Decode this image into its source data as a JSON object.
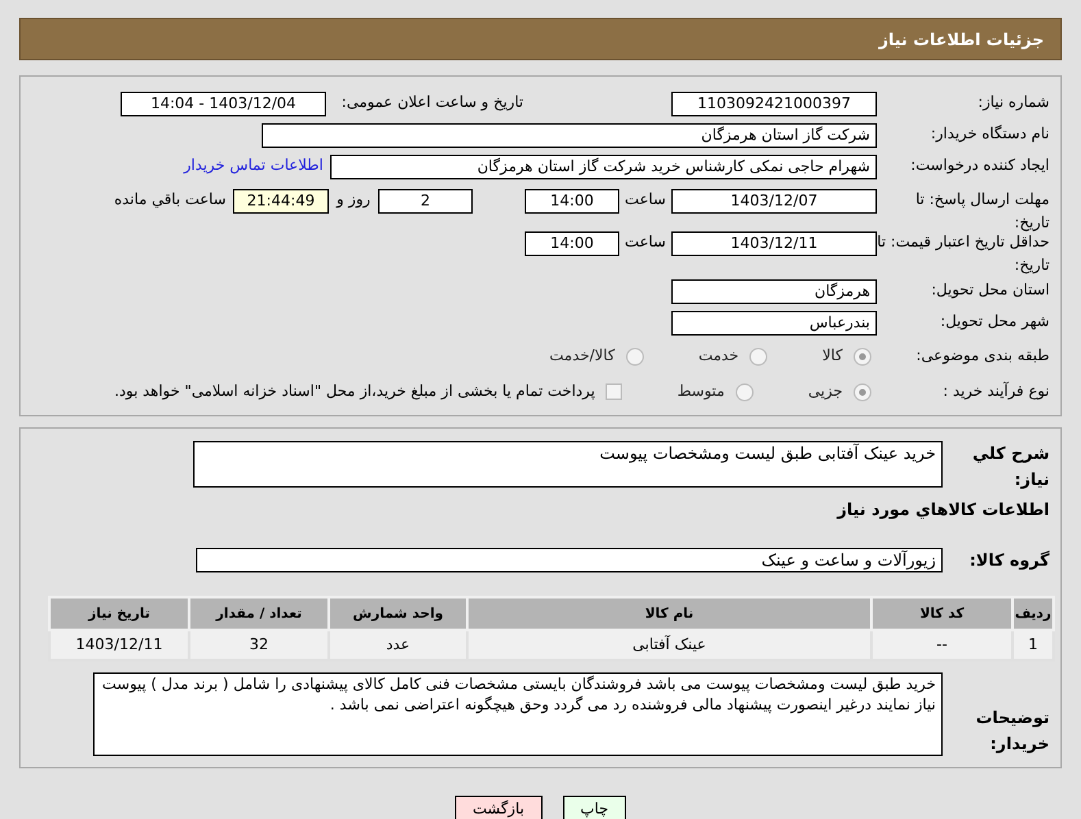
{
  "header": {
    "title": "جزئیات اطلاعات نیاز"
  },
  "need_number": {
    "label": "شماره نیاز:",
    "value": "1103092421000397"
  },
  "announce": {
    "label": "تاریخ و ساعت اعلان عمومی:",
    "value": "1403/12/04 - 14:04"
  },
  "buyer_org": {
    "label": "نام دستگاه خریدار:",
    "value": "شرکت گاز استان هرمزگان"
  },
  "requester": {
    "label": "ایجاد کننده درخواست:",
    "value": "شهرام حاجی نمکی کارشناس خرید شرکت گاز استان هرمزگان",
    "link": "اطلاعات تماس خریدار"
  },
  "reply_deadline": {
    "label": "مهلت ارسال پاسخ: تا تاریخ:",
    "date": "1403/12/07",
    "time_label": "ساعت",
    "time": "14:00",
    "days": "2",
    "days_label": "روز و",
    "remaining": "21:44:49",
    "remaining_label": "ساعت باقي مانده"
  },
  "price_validity": {
    "label": "حداقل تاریخ اعتبار قیمت: تا تاریخ:",
    "date": "1403/12/11",
    "time_label": "ساعت",
    "time": "14:00"
  },
  "province": {
    "label": "استان محل تحویل:",
    "value": "هرمزگان"
  },
  "city": {
    "label": "شهر محل تحویل:",
    "value": "بندرعباس"
  },
  "category": {
    "label": "طبقه بندی موضوعی:",
    "options": [
      {
        "label": "کالا",
        "selected": true
      },
      {
        "label": "خدمت",
        "selected": false
      },
      {
        "label": "کالا/خدمت",
        "selected": false
      }
    ]
  },
  "process": {
    "label": "نوع فرآیند خرید :",
    "options": [
      {
        "label": "جزیی",
        "selected": true
      },
      {
        "label": "متوسط",
        "selected": false
      }
    ],
    "treasury": {
      "label": "پرداخت تمام یا بخشی از مبلغ خرید،از محل \"اسناد خزانه اسلامی\" خواهد بود.",
      "checked": false
    }
  },
  "description": {
    "label": "شرح کلي نياز:",
    "value": "خرید عینک آفتابی طبق لیست ومشخصات پیوست"
  },
  "goods_heading": "اطلاعات كالاهاي مورد نياز",
  "goods_group": {
    "label": "گروه کالا:",
    "value": "زیورآلات و ساعت و عینک"
  },
  "table": {
    "columns": [
      "ردیف",
      "کد کالا",
      "نام کالا",
      "واحد شمارش",
      "تعداد / مقدار",
      "تاریخ نیاز"
    ],
    "rows": [
      [
        "1",
        "--",
        "عینک آفتابی",
        "عدد",
        "32",
        "1403/12/11"
      ]
    ]
  },
  "buyer_notes": {
    "label": "توضیحات خریدار:",
    "value": "خرید طبق لیست ومشخصات پیوست می باشد  فروشندگان بایستی مشخصات فنی کامل کالای پیشنهادی را شامل ( برند مدل  )  پیوست نیاز نمایند درغیر اینصورت پیشنهاد مالی فروشنده رد می گردد وحق هیچگونه اعتراضی نمی باشد ."
  },
  "buttons": [
    {
      "label": "چاپ",
      "kind": "print"
    },
    {
      "label": "بازگشت",
      "kind": "back"
    }
  ]
}
